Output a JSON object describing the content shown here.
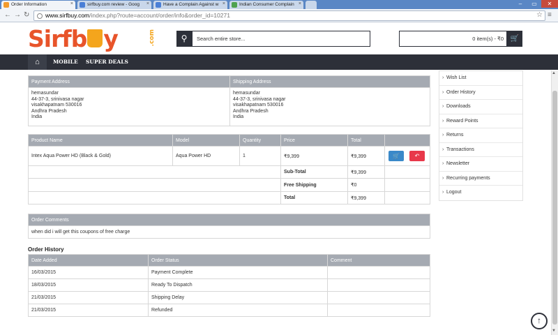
{
  "browser": {
    "tabs": [
      {
        "title": "Order Information"
      },
      {
        "title": "sirfbuy.com review - Goog"
      },
      {
        "title": "Have a Complain Against w"
      },
      {
        "title": "Indian Consumer Complain"
      }
    ],
    "url_host": "www.sirfbuy.com",
    "url_path": "/index.php?route=account/order/info&order_id=10271"
  },
  "header": {
    "logo_text": "Sirfbuy",
    "logo_pre": "Sirfb",
    "logo_post": "y",
    "logo_suffix": ".com",
    "search_placeholder": "Search entire store...",
    "cart_text": "0 item(s) - ₹0"
  },
  "nav": {
    "items": [
      "MOBILE",
      "SUPER DEALS"
    ]
  },
  "address": {
    "payment_header": "Payment Address",
    "shipping_header": "Shipping Address",
    "payment_lines": [
      "hemasundar",
      "44-37-3, srinivasa nagar",
      "visakhapatnam 530016",
      "Andhra Pradesh",
      "India"
    ],
    "shipping_lines": [
      "hemasundar",
      "44-37-3, srinivasa nagar",
      "visakhapatnam 530016",
      "Andhra Pradesh",
      "India"
    ]
  },
  "products": {
    "headers": [
      "Product Name",
      "Model",
      "Quantity",
      "Price",
      "Total",
      ""
    ],
    "rows": [
      {
        "name": "Intex Aqua Power HD (Black & Gold)",
        "model": "Aqua Power HD",
        "quantity": "1",
        "price": "₹9,399",
        "total": "₹9,399"
      }
    ],
    "totals": [
      {
        "label": "Sub-Total",
        "value": "₹9,399"
      },
      {
        "label": "Free Shipping",
        "value": "₹0"
      },
      {
        "label": "Total",
        "value": "₹9,399"
      }
    ]
  },
  "comments": {
    "header": "Order Comments",
    "text": "when did i will get this coupons of free charge"
  },
  "history": {
    "title": "Order History",
    "headers": [
      "Date Added",
      "Order Status",
      "Comment"
    ],
    "rows": [
      {
        "date": "16/03/2015",
        "status": "Payment Complete",
        "comment": ""
      },
      {
        "date": "18/03/2015",
        "status": "Ready To Dispatch",
        "comment": ""
      },
      {
        "date": "21/03/2015",
        "status": "Shipping Delay",
        "comment": ""
      },
      {
        "date": "21/03/2015",
        "status": "Refunded",
        "comment": ""
      }
    ]
  },
  "sidebar": {
    "items": [
      "Wish List",
      "Order History",
      "Downloads",
      "Reward Points",
      "Returns",
      "Transactions",
      "Newsletter",
      "Recurring payments",
      "Logout"
    ]
  },
  "colors": {
    "brand": "#e8542a",
    "accent": "#f4a51c",
    "dark": "#2d3039",
    "table_header": "#a5aab2"
  }
}
